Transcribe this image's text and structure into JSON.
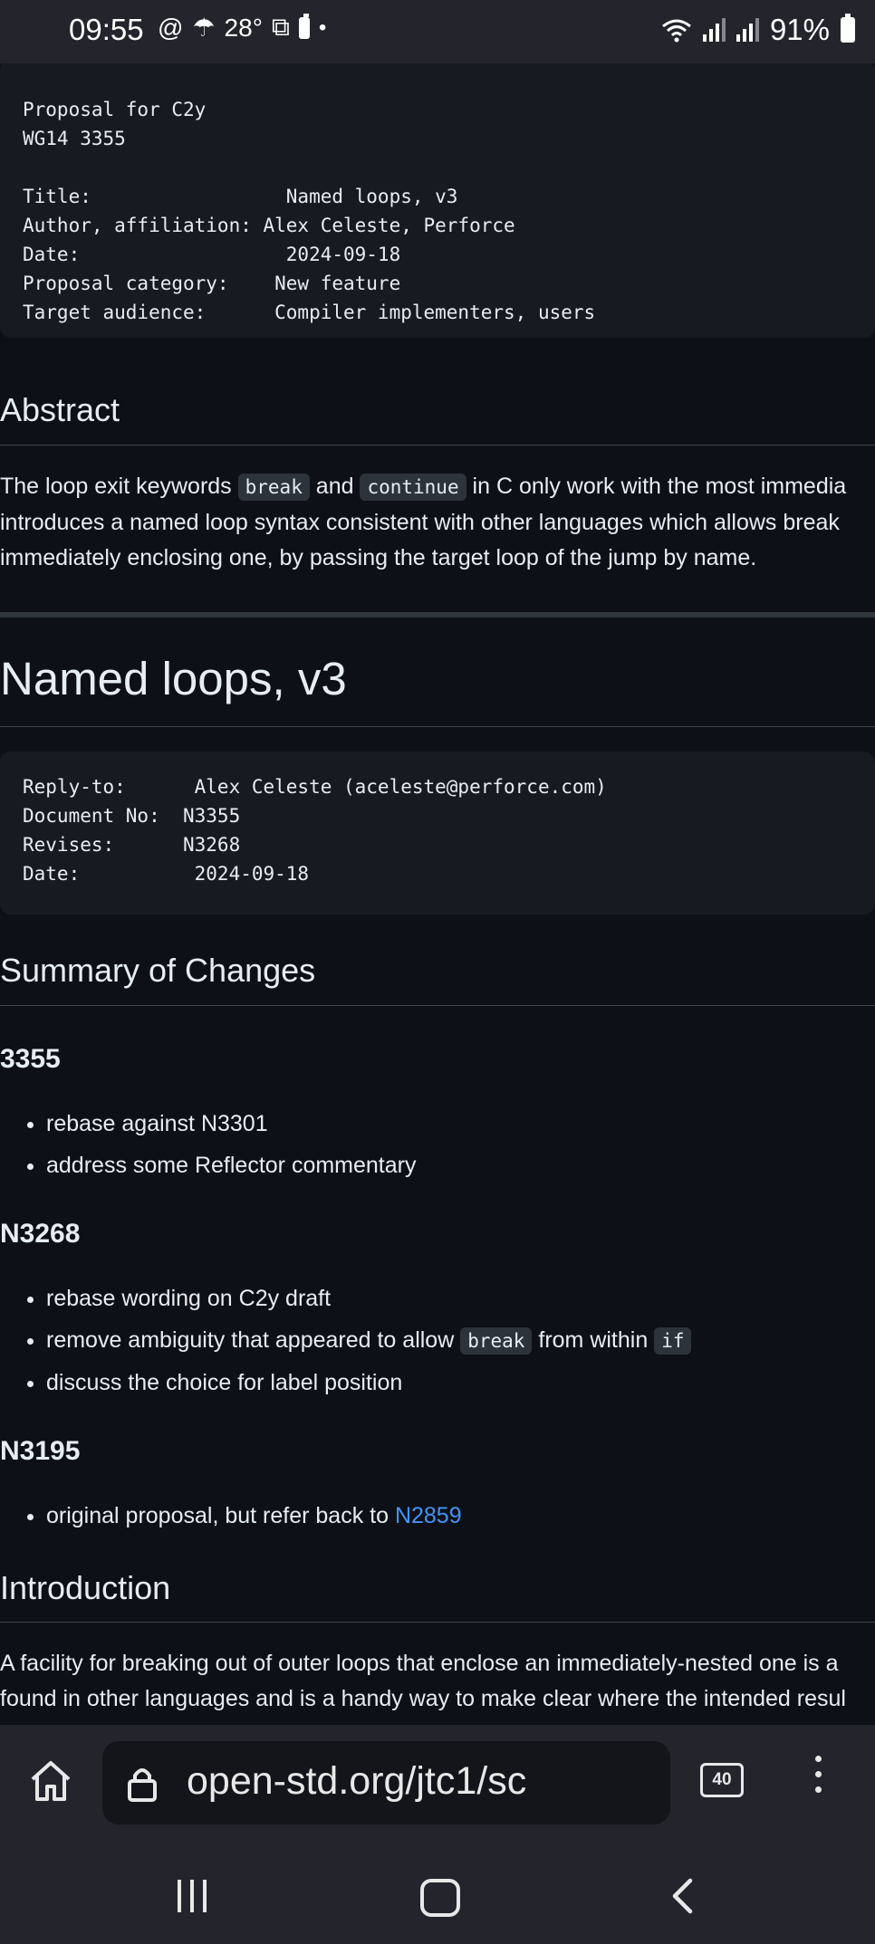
{
  "status_bar": {
    "time": "09:55",
    "temperature": "28°",
    "battery": "91%"
  },
  "meta_block": {
    "lines": [
      "Proposal for C2y",
      "WG14 3355",
      "",
      "Title:                 Named loops, v3",
      "Author, affiliation: Alex Celeste, Perforce",
      "Date:                  2024-09-18",
      "Proposal category:    New feature",
      "Target audience:      Compiler implementers, users"
    ]
  },
  "abstract": {
    "heading": "Abstract",
    "line1_before": "The loop exit keywords ",
    "code_break": "break",
    "line1_mid": " and ",
    "code_continue": "continue",
    "line1_after": " in C only work with the most immedia",
    "line2": "introduces a named loop syntax consistent with other languages which allows break",
    "line3": "immediately enclosing one, by passing the target loop of the jump by name."
  },
  "doc_title": "Named loops, v3",
  "doc_block": {
    "lines": [
      "Reply-to:      Alex Celeste (aceleste@perforce.com)",
      "Document No:  N3355",
      "Revises:      N3268",
      "Date:          2024-09-18"
    ]
  },
  "summary": {
    "heading": "Summary of Changes",
    "v1": {
      "title": "3355",
      "items": [
        "rebase against N3301",
        "address some Reflector commentary"
      ]
    },
    "v2": {
      "title": "N3268",
      "item1": "rebase wording on C2y draft",
      "item2_before": "remove ambiguity that appeared to allow ",
      "item2_code1": "break",
      "item2_mid": " from within ",
      "item2_code2": "if",
      "item3": "discuss the choice for label position"
    },
    "v3": {
      "title": "N3195",
      "item1_before": "original proposal, but refer back to ",
      "item1_link": "N2859"
    }
  },
  "introduction": {
    "heading": "Introduction",
    "line1": "A facility for breaking out of outer loops that enclose an immediately-nested one is a",
    "line2": "found in other languages and is a handy way to make clear where the intended resul"
  },
  "browser": {
    "url": "open-std.org/jtc1/sc",
    "tab_count": "40"
  },
  "icons": [
    "home-icon",
    "lock-icon",
    "reader-mode-icon",
    "tabs-icon",
    "menu-icon",
    "recents-icon",
    "nav-home-icon",
    "back-icon",
    "wifi-icon",
    "signal-icon",
    "battery-icon"
  ]
}
